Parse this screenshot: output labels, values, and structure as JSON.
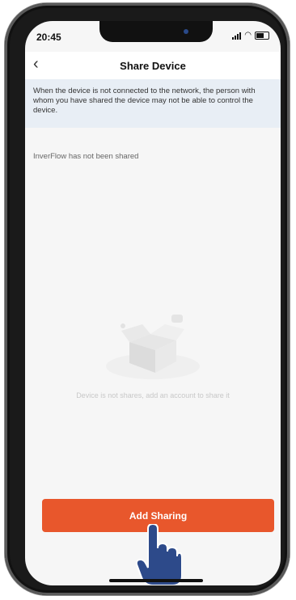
{
  "status_bar": {
    "time": "20:45"
  },
  "header": {
    "title": "Share Device"
  },
  "notice": {
    "text": "When the device is not connected to the network, the person with whom you have shared the device may not be able to control the device."
  },
  "share_status": {
    "text": "InverFlow has not been shared"
  },
  "empty_state": {
    "text": "Device is not shares, add an account to share it"
  },
  "actions": {
    "add_sharing_label": "Add Sharing"
  },
  "colors": {
    "accent": "#e8572c",
    "notice_bg": "#e8eef5",
    "hand": "#2d4a8a"
  }
}
